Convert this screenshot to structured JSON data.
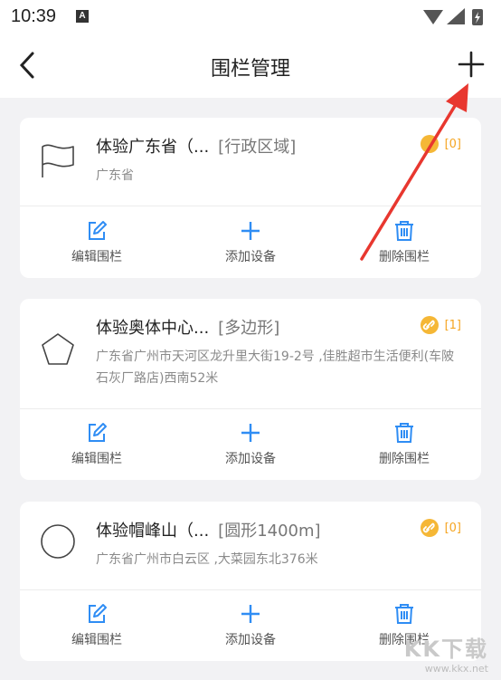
{
  "status_bar": {
    "time": "10:39",
    "notification_letter": "A"
  },
  "nav": {
    "title": "围栏管理"
  },
  "fences": [
    {
      "title": "体验广东省（...",
      "type": "[行政区域]",
      "address": "广东省",
      "count": "[0]",
      "badge_icon": "smile-icon",
      "shape_icon": "flag-icon"
    },
    {
      "title": "体验奥体中心...",
      "type": "[多边形]",
      "address": "广东省广州市天河区龙升里大街19-2号 ,佳胜超市生活便利(车陂石灰厂路店)西南52米",
      "count": "[1]",
      "badge_icon": "link-icon",
      "shape_icon": "pentagon-icon"
    },
    {
      "title": "体验帽峰山（...",
      "type": "[圆形1400m]",
      "address": "广东省广州市白云区 ,大菜园东北376米",
      "count": "[0]",
      "badge_icon": "link-icon",
      "shape_icon": "circle-icon"
    }
  ],
  "actions": {
    "edit": "编辑围栏",
    "add_device": "添加设备",
    "delete": "删除围栏"
  },
  "watermark": {
    "big": "KK下载",
    "small": "www.kkx.net"
  },
  "colors": {
    "accent_blue": "#2f8df4",
    "badge_orange": "#f5b736",
    "arrow_red": "#e8372f"
  }
}
